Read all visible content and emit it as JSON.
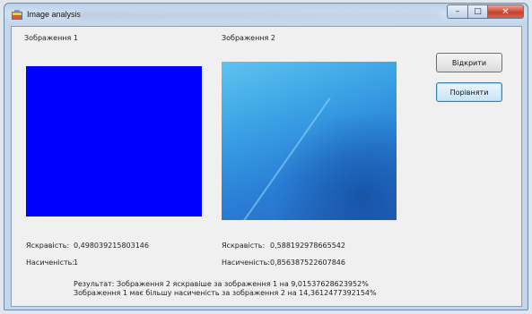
{
  "window": {
    "title": "Image analysis",
    "buttons": {
      "minimize": "–",
      "maximize": "□",
      "close": "✕"
    }
  },
  "images": {
    "image1_label": "Зображення 1",
    "image2_label": "Зображення 2",
    "image1_color": "#0000ff"
  },
  "buttons": {
    "open": "Відкрити",
    "compare": "Порівняти"
  },
  "stats": {
    "brightness_label": "Яскравість:",
    "saturation_label": "Насиченість:",
    "image1_brightness": "0,498039215803146",
    "image1_saturation": "1",
    "image2_brightness": "0,588192978665542",
    "image2_saturation": "0,856387522607846"
  },
  "result": {
    "line1": "Результат: Зображення 2 яскравіше за зображення 1 на 9,01537628623952%",
    "line2": "Зображення 1 має більшу насиченість за зображення 2 на 14,3612477392154%"
  }
}
